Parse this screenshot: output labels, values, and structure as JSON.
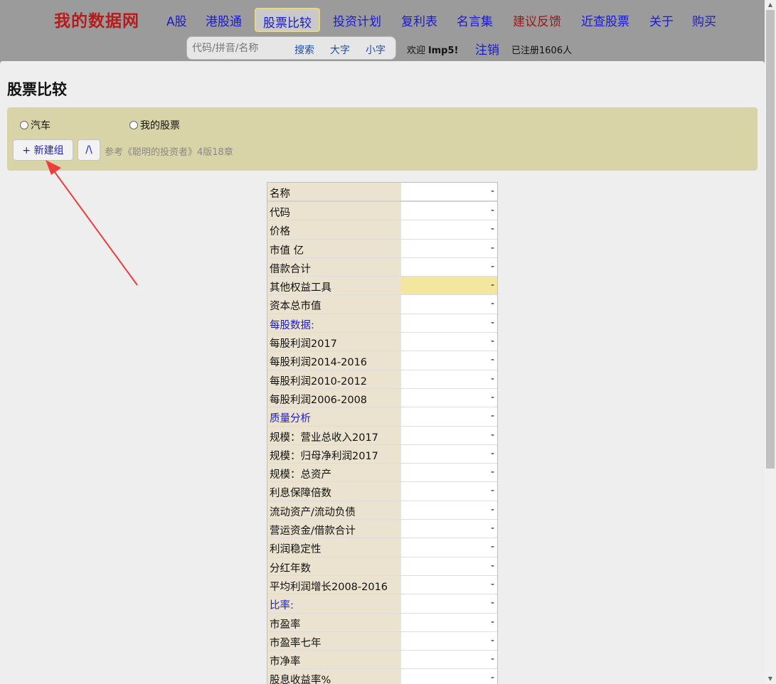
{
  "header": {
    "brand": "我的数据网",
    "nav": [
      {
        "label": "A股",
        "active": false
      },
      {
        "label": "港股通",
        "active": false
      },
      {
        "label": "股票比较",
        "active": true
      },
      {
        "label": "投资计划",
        "active": false
      },
      {
        "label": "复利表",
        "active": false
      },
      {
        "label": "名言集",
        "active": false
      },
      {
        "label": "建议反馈",
        "active": false
      },
      {
        "label": "近查股票",
        "active": false
      },
      {
        "label": "关于",
        "active": false
      },
      {
        "label": "购买",
        "active": false
      }
    ],
    "search": {
      "placeholder": "代码/拼音/名称",
      "search_label": "搜索",
      "large_font_label": "大字",
      "small_font_label": "小字"
    },
    "welcome_prefix": "欢迎",
    "username": "lmp5!",
    "logout_label": "注销",
    "registered": "已注册1606人"
  },
  "page": {
    "title": "股票比较",
    "groups": [
      {
        "label": "汽车"
      },
      {
        "label": "我的股票"
      }
    ],
    "new_group_label": "+ 新建组",
    "collapse_label": "/\\",
    "reference": "参考《聪明的投资者》4版18章"
  },
  "table": {
    "rows": [
      {
        "label": "名称",
        "value": "-"
      },
      {
        "label": "代码",
        "value": "-"
      },
      {
        "label": "价格",
        "value": "-"
      },
      {
        "label": "市值 亿",
        "value": "-"
      },
      {
        "label": "借款合计",
        "value": "-"
      },
      {
        "label": "其他权益工具",
        "value": "-"
      },
      {
        "label": "资本总市值",
        "value": "-"
      },
      {
        "label": "每股数据:",
        "value": "-"
      },
      {
        "label": "每股利润2017",
        "value": "-"
      },
      {
        "label": "每股利润2014-2016",
        "value": "-"
      },
      {
        "label": "每股利润2010-2012",
        "value": "-"
      },
      {
        "label": "每股利润2006-2008",
        "value": "-"
      },
      {
        "label": "质量分析",
        "value": "-"
      },
      {
        "label": "规模：营业总收入2017",
        "value": "-"
      },
      {
        "label": "规模：归母净利润2017",
        "value": "-"
      },
      {
        "label": "规模：总资产",
        "value": "-"
      },
      {
        "label": "利息保障倍数",
        "value": "-"
      },
      {
        "label": "流动资产/流动负债",
        "value": "-"
      },
      {
        "label": "营运资金/借款合计",
        "value": "-"
      },
      {
        "label": "利润稳定性",
        "value": "-"
      },
      {
        "label": "分红年数",
        "value": "-"
      },
      {
        "label": "平均利润增长2008-2016",
        "value": "-"
      },
      {
        "label": "比率:",
        "value": "-"
      },
      {
        "label": "市盈率",
        "value": "-"
      },
      {
        "label": "市盈率七年",
        "value": "-"
      },
      {
        "label": "市净率",
        "value": "-"
      },
      {
        "label": "股息收益率%",
        "value": "-"
      }
    ]
  }
}
